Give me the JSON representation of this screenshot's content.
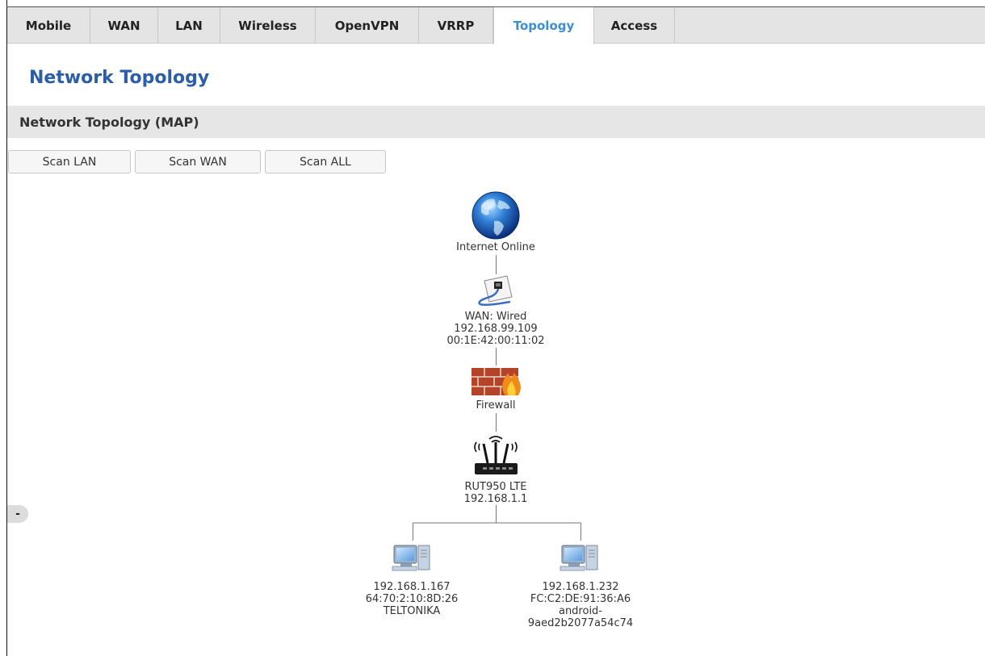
{
  "tabs": [
    {
      "label": "Mobile",
      "active": false
    },
    {
      "label": "WAN",
      "active": false
    },
    {
      "label": "LAN",
      "active": false
    },
    {
      "label": "Wireless",
      "active": false
    },
    {
      "label": "OpenVPN",
      "active": false
    },
    {
      "label": "VRRP",
      "active": false
    },
    {
      "label": "Topology",
      "active": true
    },
    {
      "label": "Access",
      "active": false
    }
  ],
  "page_title": "Network Topology",
  "section_title": "Network Topology (MAP)",
  "buttons": {
    "scan_lan": "Scan LAN",
    "scan_wan": "Scan WAN",
    "scan_all": "Scan ALL"
  },
  "zoom_button": "-",
  "topology": {
    "internet": {
      "status": "Internet Online",
      "icon": "globe-icon"
    },
    "wan": {
      "type": "WAN: Wired",
      "ip": "192.168.99.109",
      "mac": "00:1E:42:00:11:02",
      "icon": "wired-connection-icon"
    },
    "firewall": {
      "label": "Firewall",
      "icon": "firewall-icon"
    },
    "router": {
      "model": "RUT950 LTE",
      "ip": "192.168.1.1",
      "icon": "router-icon"
    },
    "clients": [
      {
        "ip": "192.168.1.167",
        "mac": "64:70:2:10:8D:26",
        "hostname": "TELTONIKA",
        "icon": "computer-icon"
      },
      {
        "ip": "192.168.1.232",
        "mac": "FC:C2:DE:91:36:A6",
        "hostname_line1": "android-",
        "hostname_line2": "9aed2b2077a54c74",
        "icon": "computer-icon"
      }
    ]
  },
  "colors": {
    "accent": "#3b8fd0",
    "title": "#2b5ea8",
    "tabbar": "#e4e4e4",
    "section_bar": "#e6e6e6"
  }
}
